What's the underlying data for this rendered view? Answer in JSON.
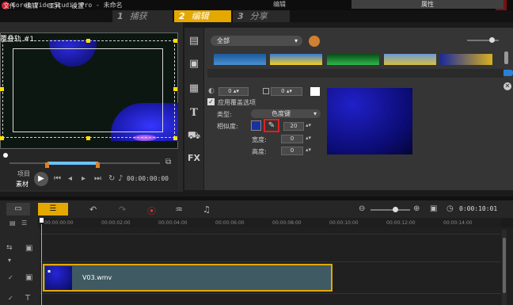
{
  "window": {
    "title": "Corel VideoStudio Pro - 未命名"
  },
  "menu": [
    "文件",
    "编辑",
    "工具",
    "设置"
  ],
  "steps": [
    {
      "num": "1",
      "label": "捕获"
    },
    {
      "num": "2",
      "label": "编辑"
    },
    {
      "num": "3",
      "label": "分享"
    }
  ],
  "preview": {
    "track_label": "覆叠轨 #1",
    "mode_project": "项目",
    "mode_clip": "素材",
    "timecode": "00:00:00:00"
  },
  "library": {
    "dropdown": "全部",
    "tabs": [
      "编辑",
      "属性"
    ]
  },
  "properties": {
    "spin1": "0",
    "spin2": "0",
    "apply_overlay_label": "应用覆盖选项",
    "type_label": "类型:",
    "type_value": "色度键",
    "similarity_label": "相似度:",
    "similarity_value": "20",
    "width_label": "宽度:",
    "width_value": "0",
    "height_label": "高度:",
    "height_value": "0"
  },
  "timeline": {
    "timecode": "0:00:10:01",
    "ruler": [
      "00:00:00:00",
      "00:00:02:00",
      "00:00:04:00",
      "00:00:06:00",
      "00:00:08:00",
      "00:00:10:00",
      "00:00:12:00",
      "00:00:14:00"
    ],
    "clip_label": "V03.wmv"
  },
  "colors": {
    "accent": "#e5a800",
    "highlight": "#e02020",
    "key_color": "#1c30a0"
  }
}
